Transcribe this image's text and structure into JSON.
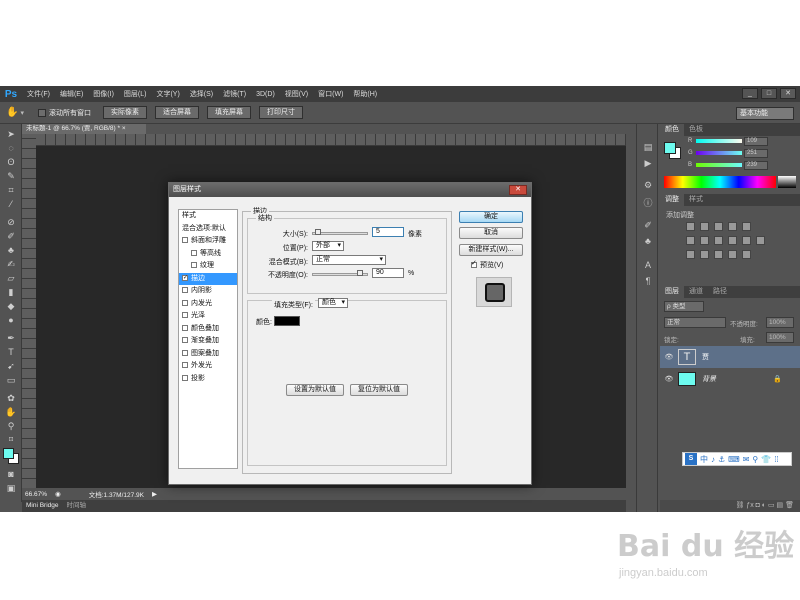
{
  "menubar": {
    "logo": "Ps",
    "items": [
      "文件(F)",
      "编辑(E)",
      "图像(I)",
      "图层(L)",
      "文字(Y)",
      "选择(S)",
      "滤镜(T)",
      "3D(D)",
      "视图(V)",
      "窗口(W)",
      "帮助(H)"
    ],
    "window_controls": [
      "_",
      "□",
      "✕"
    ]
  },
  "options": {
    "scroll_all_label": "滚动所有窗口",
    "buttons": [
      "实际像素",
      "适合屏幕",
      "填充屏幕",
      "打印尺寸"
    ],
    "workspace": "基本功能"
  },
  "document": {
    "tab_title": "未标题-1 @ 66.7% (贾, RGB/8) *",
    "tab_close": "×"
  },
  "status": {
    "zoom": "66.67%",
    "doc_size": "文档:1.37M/127.9K"
  },
  "bottom_tabs": [
    "Mini Bridge",
    "时间轴"
  ],
  "color_panel": {
    "tabs": [
      "颜色",
      "色板"
    ],
    "channels": [
      {
        "label": "R",
        "value": "109"
      },
      {
        "label": "G",
        "value": "251"
      },
      {
        "label": "B",
        "value": "239"
      }
    ],
    "foreground": "#6dfbef",
    "accent": "#6dfbef"
  },
  "adjust_panel": {
    "tabs": [
      "调整",
      "样式"
    ],
    "title": "添加调整"
  },
  "layers_panel": {
    "tabs": [
      "图层",
      "通道",
      "路径"
    ],
    "kind": "ρ 类型",
    "mode": "正常",
    "opacity_label": "不透明度:",
    "opacity": "100%",
    "lock_label": "锁定:",
    "fill_label": "填充:",
    "fill": "100%",
    "layers": [
      {
        "name": "贾",
        "type": "text"
      },
      {
        "name": "背景",
        "type": "image",
        "color": "#6dfbef"
      }
    ]
  },
  "dialog": {
    "title": "图层样式",
    "close_label": "✕",
    "styles": [
      {
        "label": "样式",
        "checkbox": false,
        "indent": false,
        "selected": false
      },
      {
        "label": "混合选项:默认",
        "checkbox": false,
        "indent": false,
        "selected": false
      },
      {
        "label": "斜面和浮雕",
        "checkbox": true,
        "checked": false,
        "indent": false,
        "selected": false
      },
      {
        "label": "等高线",
        "checkbox": true,
        "checked": false,
        "indent": true,
        "selected": false
      },
      {
        "label": "纹理",
        "checkbox": true,
        "checked": false,
        "indent": true,
        "selected": false
      },
      {
        "label": "描边",
        "checkbox": true,
        "checked": true,
        "indent": false,
        "selected": true
      },
      {
        "label": "内阴影",
        "checkbox": true,
        "checked": false,
        "indent": false,
        "selected": false
      },
      {
        "label": "内发光",
        "checkbox": true,
        "checked": false,
        "indent": false,
        "selected": false
      },
      {
        "label": "光泽",
        "checkbox": true,
        "checked": false,
        "indent": false,
        "selected": false
      },
      {
        "label": "颜色叠加",
        "checkbox": true,
        "checked": false,
        "indent": false,
        "selected": false
      },
      {
        "label": "渐变叠加",
        "checkbox": true,
        "checked": false,
        "indent": false,
        "selected": false
      },
      {
        "label": "图案叠加",
        "checkbox": true,
        "checked": false,
        "indent": false,
        "selected": false
      },
      {
        "label": "外发光",
        "checkbox": true,
        "checked": false,
        "indent": false,
        "selected": false
      },
      {
        "label": "投影",
        "checkbox": true,
        "checked": false,
        "indent": false,
        "selected": false
      }
    ],
    "stroke": {
      "section": "描边",
      "structure": "结构",
      "size_label": "大小(S):",
      "size_value": "5",
      "size_unit": "像素",
      "size_level": 0.05,
      "position_label": "位置(P):",
      "position_value": "外部",
      "blend_label": "混合模式(B):",
      "blend_value": "正常",
      "opacity_label": "不透明度(O):",
      "opacity_value": "90",
      "opacity_unit": "%",
      "opacity_level": 0.9,
      "fill_type_label": "填充类型(F):",
      "fill_type_value": "颜色",
      "color_label": "颜色:",
      "color": "#000000"
    },
    "buttons": {
      "ok": "确定",
      "cancel": "取消",
      "new_style": "新建样式(W)...",
      "preview": "预览(V)",
      "set_default": "设置为默认值",
      "reset_default": "复位为默认值"
    }
  },
  "watermark": {
    "brand": "Bai du 经验",
    "url": "jingyan.baidu.com"
  },
  "ime": {
    "items": [
      "中",
      "♪",
      "⚓",
      "⌨",
      "✉",
      "⚲",
      "👕",
      "⁞⁞"
    ]
  }
}
